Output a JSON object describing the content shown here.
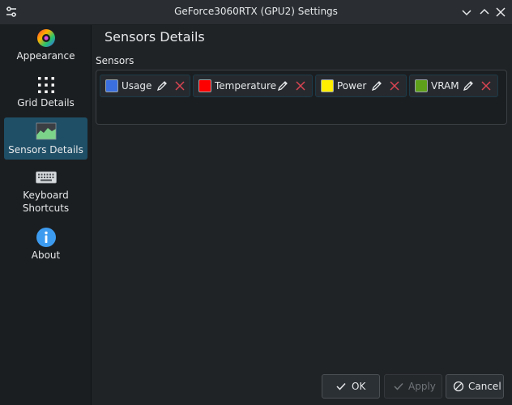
{
  "window": {
    "title": "GeForce3060RTX (GPU2) Settings"
  },
  "sidebar": {
    "items": [
      {
        "label": "Appearance",
        "icon": "appearance-icon"
      },
      {
        "label": "Grid Details",
        "icon": "grid-icon"
      },
      {
        "label": "Sensors Details",
        "icon": "sensors-icon",
        "active": true
      },
      {
        "label": "Keyboard\nShortcuts",
        "icon": "keyboard-icon"
      },
      {
        "label": "About",
        "icon": "info-icon"
      }
    ]
  },
  "main": {
    "title": "Sensors Details",
    "group_label": "Sensors",
    "sensors": [
      {
        "label": "Usage",
        "color": "#3b6fe0"
      },
      {
        "label": "Temperature",
        "color": "#ff0000"
      },
      {
        "label": "Power",
        "color": "#ffee00"
      },
      {
        "label": "VRAM",
        "color": "#5fa01a"
      }
    ]
  },
  "buttons": {
    "ok": "OK",
    "apply": "Apply",
    "cancel": "Cancel"
  },
  "colors": {
    "accent": "#1f4f67",
    "close_red": "#da4453"
  }
}
